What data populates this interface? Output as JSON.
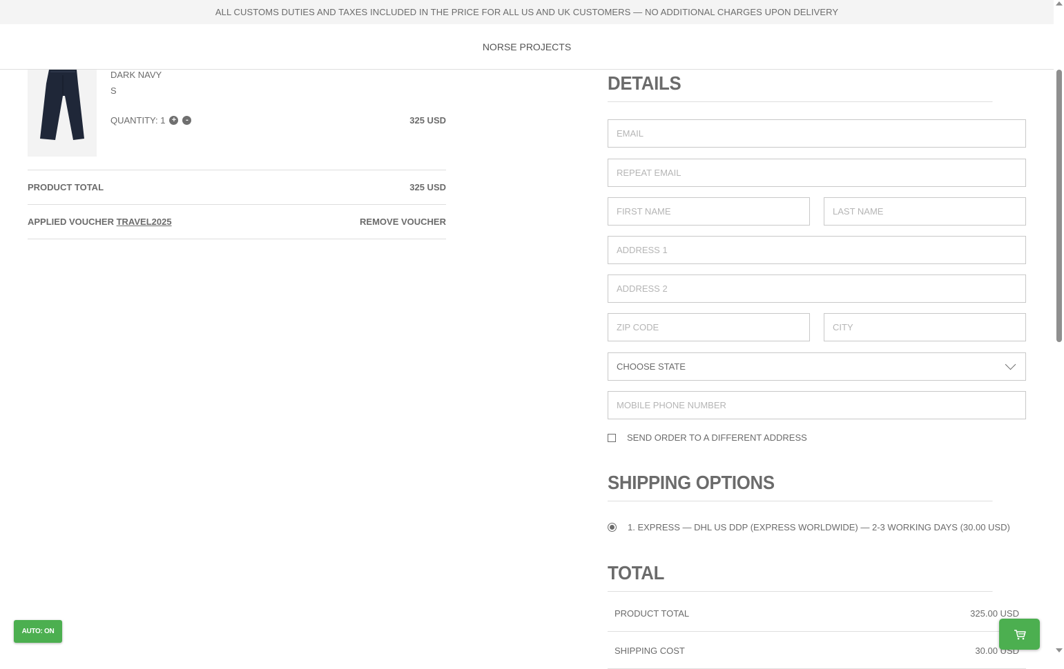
{
  "banner": {
    "text": "ALL CUSTOMS DUTIES AND TAXES INCLUDED IN THE PRICE FOR ALL US AND UK CUSTOMERS — NO ADDITIONAL CHARGES UPON DELIVERY"
  },
  "header": {
    "brand": "NORSE PROJECTS"
  },
  "cart": {
    "item": {
      "color": "DARK NAVY",
      "size": "S",
      "quantity_label": "QUANTITY: 1",
      "increase": "+",
      "decrease": "-",
      "price": "325 USD"
    },
    "product_total_label": "PRODUCT TOTAL",
    "product_total_value": "325 USD",
    "voucher_label": "APPLIED VOUCHER",
    "voucher_code": "TRAVEL2025",
    "remove_voucher": "REMOVE VOUCHER"
  },
  "details": {
    "title": "DETAILS",
    "fields": {
      "email": "EMAIL",
      "repeat_email": "REPEAT EMAIL",
      "first_name": "FIRST NAME",
      "last_name": "LAST NAME",
      "address1": "ADDRESS 1",
      "address2": "ADDRESS 2",
      "zip": "ZIP CODE",
      "city": "CITY",
      "state": "CHOOSE STATE",
      "phone": "MOBILE PHONE NUMBER"
    },
    "different_address": "SEND ORDER TO A DIFFERENT ADDRESS"
  },
  "shipping": {
    "title": "SHIPPING OPTIONS",
    "option": "1. EXPRESS — DHL US DDP (EXPRESS WORLDWIDE) — 2-3 WORKING DAYS (30.00 USD)"
  },
  "total": {
    "title": "TOTAL",
    "rows": [
      {
        "label": "PRODUCT TOTAL",
        "value": "325.00 USD"
      },
      {
        "label": "SHIPPING COST",
        "value": "30.00 USD"
      }
    ]
  },
  "widgets": {
    "auto": "AUTO: ON",
    "cart_icon": "cart-icon"
  },
  "colors": {
    "accent_green": "#4caf50",
    "text": "#6b6b6b",
    "border": "#c8c8c8"
  }
}
